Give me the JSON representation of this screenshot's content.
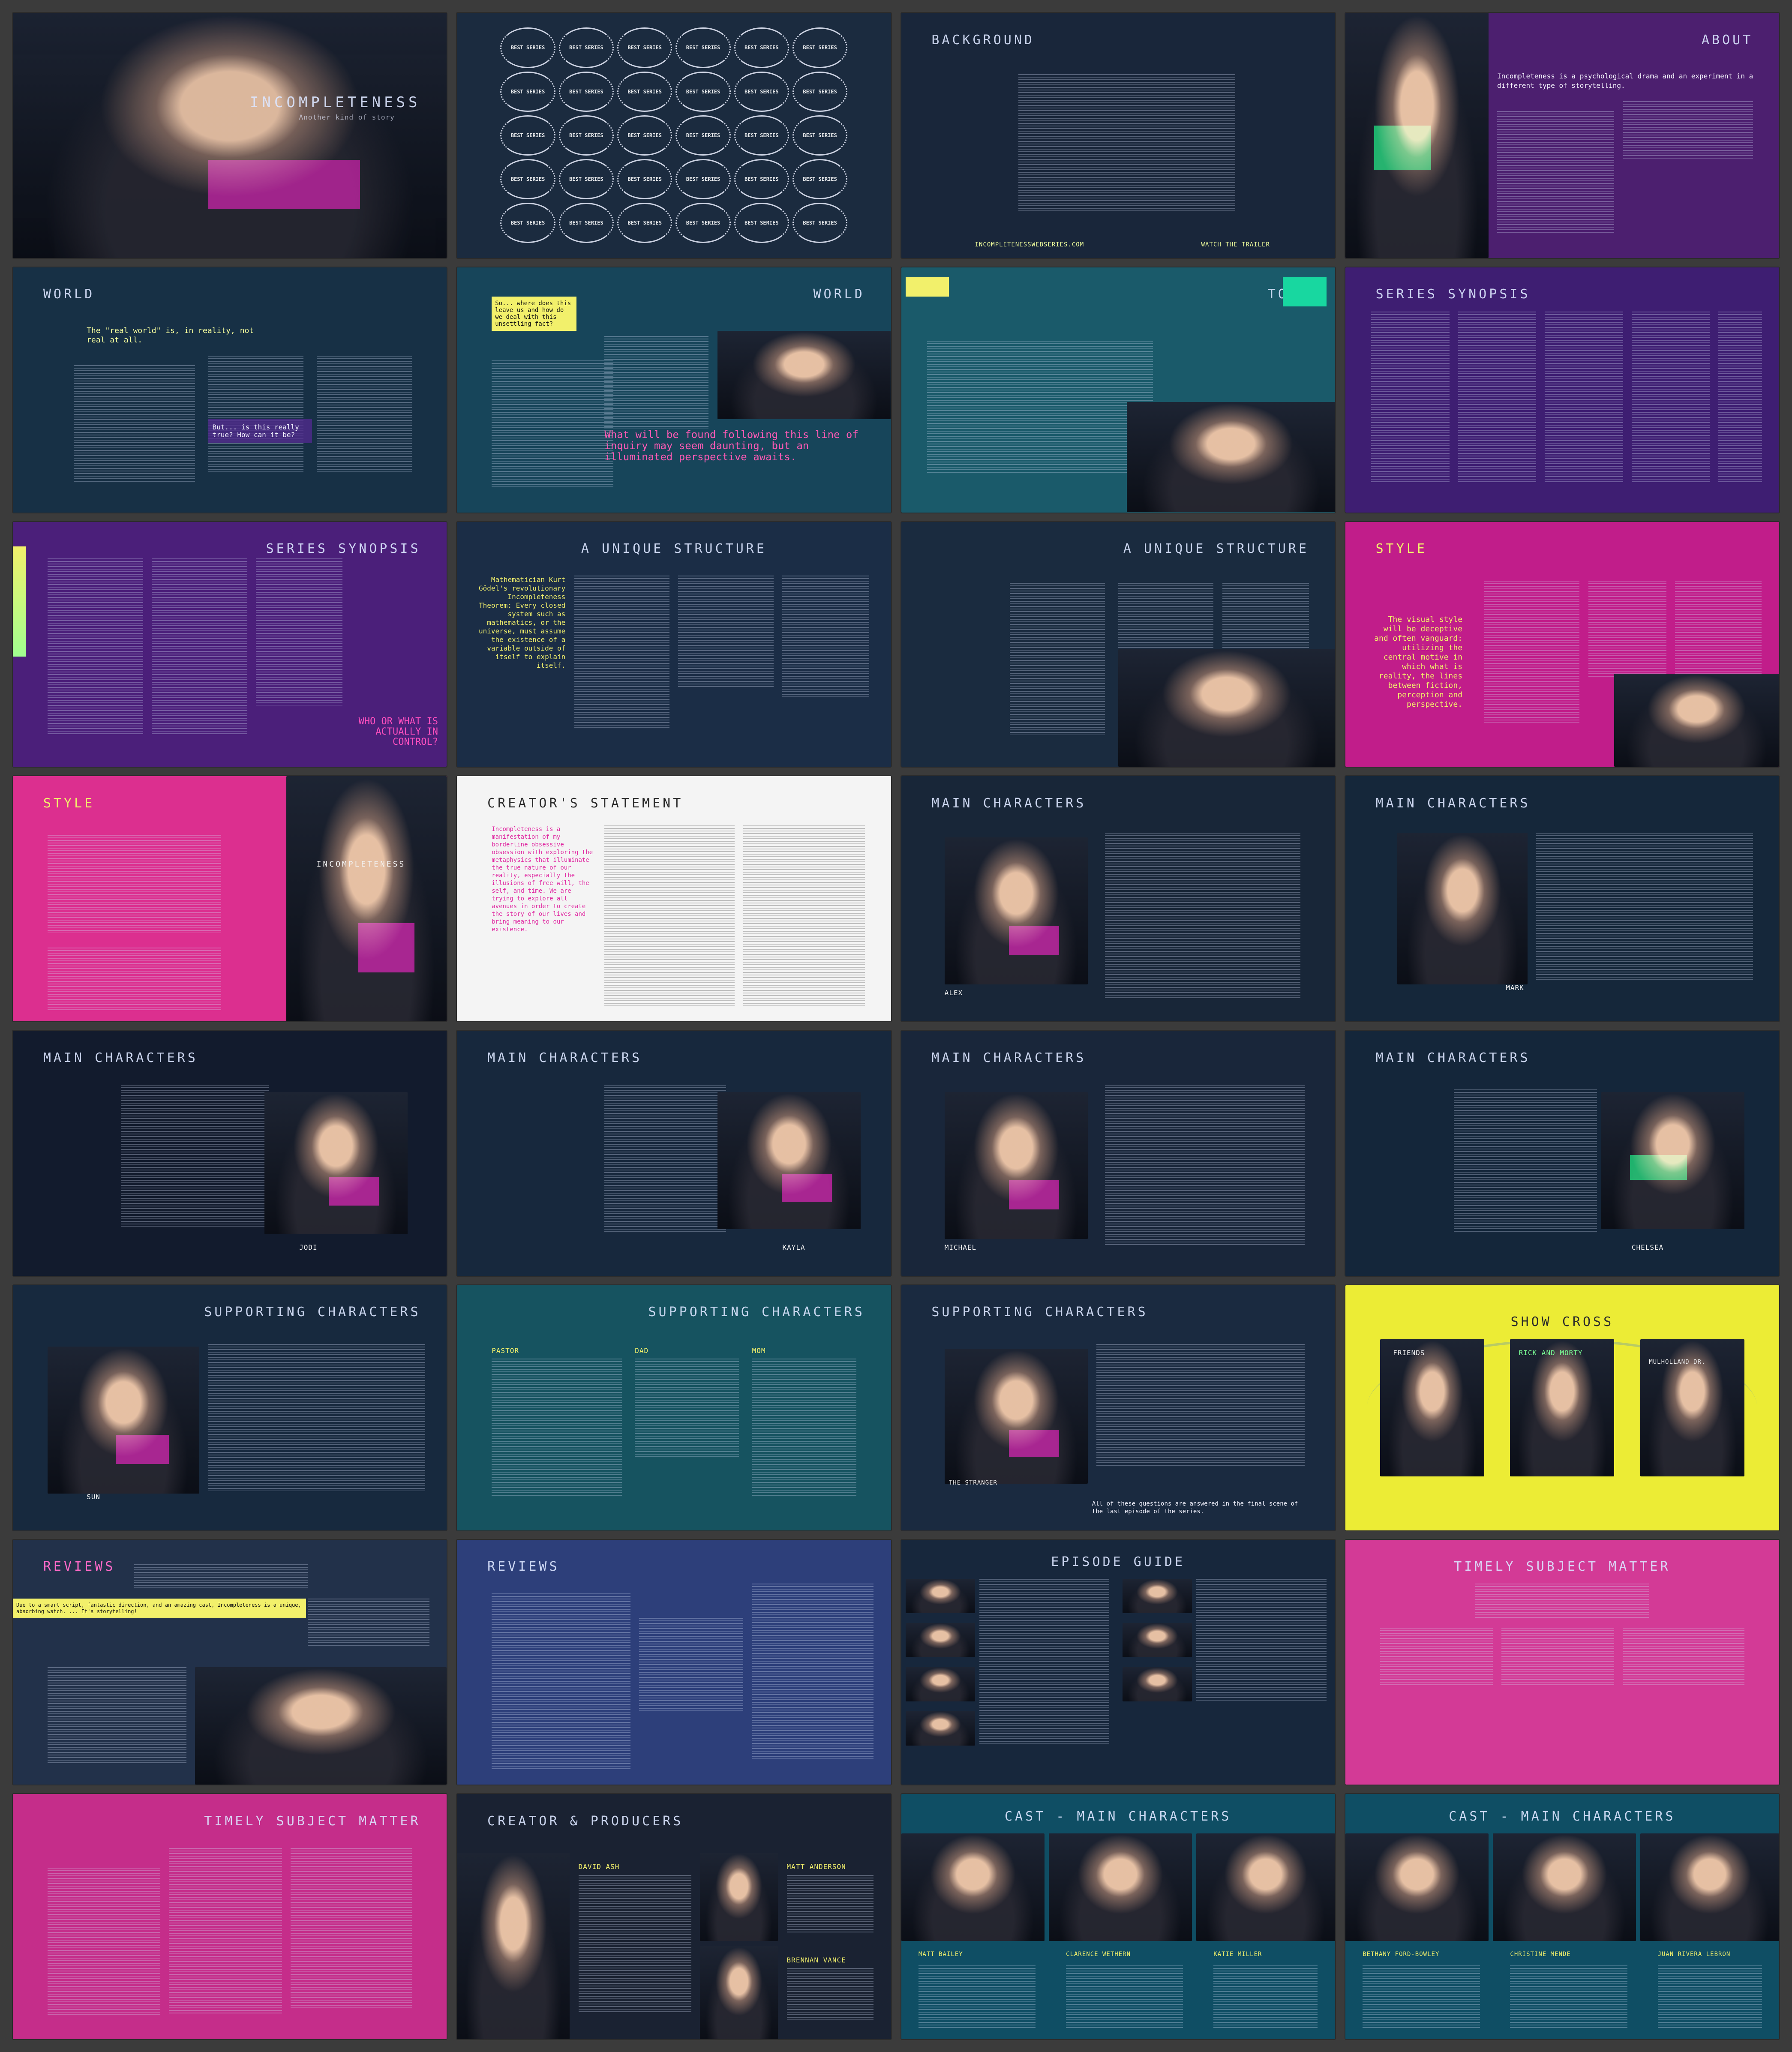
{
  "slides": [
    {
      "title": "INCOMPLETENESS",
      "subtitle": "Another kind of story",
      "bg": "#0e121c"
    },
    {
      "title": "",
      "laurel_labels": [
        "BEST SERIES",
        "BEST SERIES",
        "BEST SERIES",
        "BEST SERIES",
        "BEST SERIES",
        "BEST SERIES",
        "BEST SERIES",
        "BEST SERIES",
        "BEST SERIES",
        "BEST SERIES",
        "BEST SERIES",
        "BEST SERIES",
        "BEST SERIES",
        "BEST SERIES",
        "BEST SERIES",
        "BEST SERIES",
        "BEST SERIES",
        "BEST SERIES",
        "BEST SERIES",
        "BEST SERIES",
        "BEST SERIES",
        "BEST SERIES",
        "BEST SERIES",
        "BEST SERIES",
        "BEST SERIES",
        "BEST SERIES",
        "BEST SERIES",
        "BEST SERIES",
        "BEST SERIES",
        "BEST SERIES"
      ],
      "bg": "#1b2b3f"
    },
    {
      "title": "BACKGROUND",
      "link_left": "INCOMPLETENESSWEBSERIES.COM",
      "link_right": "WATCH THE TRAILER",
      "bg": "#19263a"
    },
    {
      "title": "ABOUT",
      "intro": "Incompleteness is a psychological drama and an experiment in a different type of storytelling.",
      "bg": "#4c1f6f"
    },
    {
      "title": "WORLD",
      "quote": "The \"real world\" is, in reality, not real at all.",
      "callout": "But... is this really true? How can it be?",
      "bg": "#173045"
    },
    {
      "title": "WORLD",
      "note": "So... where does this leave us and how do we deal with this unsettling fact?",
      "highlight": "What will be found following this line of inquiry may seem daunting, but an illuminated perspective awaits.",
      "bg": "#17455a"
    },
    {
      "title": "TONE",
      "bg": "#1a5a6a"
    },
    {
      "title": "SERIES SYNOPSIS",
      "bg": "#3e1e72"
    },
    {
      "title": "SERIES SYNOPSIS",
      "question": "WHO OR WHAT IS ACTUALLY IN CONTROL?",
      "bg": "#4b1f7a"
    },
    {
      "title": "A UNIQUE STRUCTURE",
      "left_col": "Mathematician Kurt Gödel's revolutionary Incompleteness Theorem: Every closed system such as mathematics, or the universe, must assume the existence of a variable outside of itself to explain itself.",
      "bg": "#1b2d46"
    },
    {
      "title": "A UNIQUE STRUCTURE",
      "bg": "#1a2b3f"
    },
    {
      "title": "STYLE",
      "lead": "The visual style will be deceptive and often vanguard: utilizing the central motive in which what is reality, the lines between fiction, perception and perspective.",
      "bg": "#c11d8a"
    },
    {
      "title": "STYLE",
      "poster_title": "INCOMPLETENESS",
      "bg": "#dc2f8f"
    },
    {
      "title": "CREATOR'S STATEMENT",
      "lead": "Incompleteness is a manifestation of my borderline obsessive obsession with exploring the metaphysics that illuminate the true nature of our reality, especially the illusions of free will, the self, and time. We are trying to explore all avenues in order to create the story of our lives and bring meaning to our existence.",
      "bg": "#f4f4f4"
    },
    {
      "title": "MAIN CHARACTERS",
      "name": "ALEX",
      "bg": "#182638"
    },
    {
      "title": "MAIN CHARACTERS",
      "name": "MARK",
      "bg": "#15273a"
    },
    {
      "title": "MAIN CHARACTERS",
      "name": "JODI",
      "bg": "#121b2d"
    },
    {
      "title": "MAIN CHARACTERS",
      "name": "KAYLA",
      "bg": "#17283d"
    },
    {
      "title": "MAIN CHARACTERS",
      "name": "MICHAEL",
      "bg": "#19263a"
    },
    {
      "title": "MAIN CHARACTERS",
      "name": "CHELSEA",
      "bg": "#14263a"
    },
    {
      "title": "SUPPORTING CHARACTERS",
      "name": "SUN",
      "bg": "#17293e"
    },
    {
      "title": "SUPPORTING CHARACTERS",
      "columns": [
        "PASTOR",
        "DAD",
        "MOM"
      ],
      "bg": "#165360"
    },
    {
      "title": "SUPPORTING CHARACTERS",
      "name": "THE STRANGER",
      "bottom": "All of these questions are answered in the final scene of the last episode of the series.",
      "bg": "#1a2a40"
    },
    {
      "title": "SHOW CROSS",
      "shows": [
        "FRIENDS",
        "Rick and Morty",
        "MULHOLLAND DR."
      ],
      "bg": "#ecec35"
    },
    {
      "title": "REVIEWS",
      "quote": "Due to a smart script, fantastic direction, and an amazing cast, Incompleteness is a unique, absorbing watch. ... It's storytelling!",
      "bg": "#22314a"
    },
    {
      "title": "REVIEWS",
      "bg": "#2d3f7a"
    },
    {
      "title": "EPISODE GUIDE",
      "bg": "#17273c"
    },
    {
      "title": "TIMELY SUBJECT MATTER",
      "bg": "#d33a96"
    },
    {
      "title": "TIMELY SUBJECT MATTER",
      "bg": "#c52d8a"
    },
    {
      "title": "CREATOR & PRODUCERS",
      "people": [
        "DAVID ASH",
        "MATT ANDERSON",
        "BRENNAN VANCE"
      ],
      "bg": "#1a2232"
    },
    {
      "title": "CAST - MAIN CHARACTERS",
      "people": [
        "MATT BAILEY",
        "CLARENCE WETHERN",
        "KATIE MILLER"
      ],
      "bg": "#0f4e64"
    },
    {
      "title": "CAST - MAIN CHARACTERS",
      "people": [
        "BETHANY FORD-BOWLEY",
        "CHRISTINE MENDE",
        "JUAN RIVERA LEBRON"
      ],
      "bg": "#0f4e64"
    }
  ],
  "colors": {
    "page_bg": "#3b3b3b",
    "accent_green": "#00ff78",
    "accent_pink": "#ff2bcf",
    "accent_yellow": "#f2f06b"
  }
}
